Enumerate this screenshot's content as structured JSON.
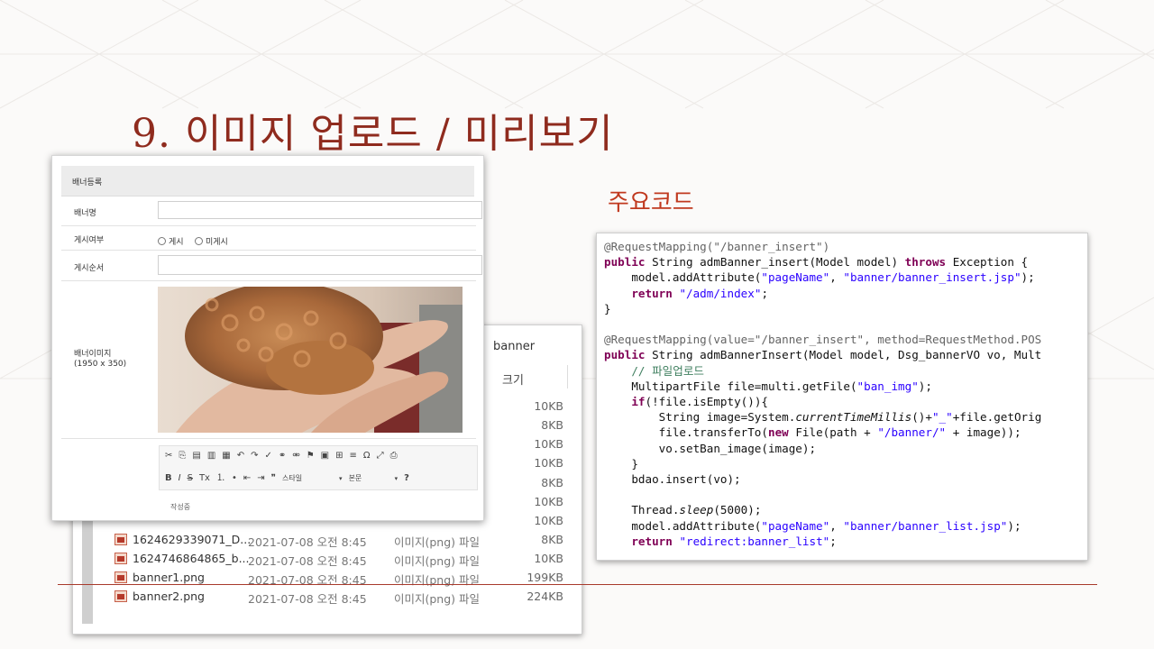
{
  "slide": {
    "title": "9. 이미지 업로드 / 미리보기",
    "code_heading": "주요코드"
  },
  "explorer": {
    "crumb": "banner",
    "col_size": "크기",
    "sizes_top": [
      "10KB",
      "8KB",
      "10KB",
      "10KB",
      "8KB",
      "10KB",
      "10KB"
    ],
    "rows": [
      {
        "name": "1624629339071_D...",
        "date": "2021-07-08 오전 8:45",
        "type": "이미지(png) 파일",
        "size": "8KB"
      },
      {
        "name": "1624746864865_b...",
        "date": "2021-07-08 오전 8:45",
        "type": "이미지(png) 파일",
        "size": "10KB"
      },
      {
        "name": "banner1.png",
        "date": "2021-07-08 오전 8:45",
        "type": "이미지(png) 파일",
        "size": "199KB"
      },
      {
        "name": "banner2.png",
        "date": "2021-07-08 오전 8:45",
        "type": "이미지(png) 파일",
        "size": "224KB"
      }
    ]
  },
  "form": {
    "header": "배너등록",
    "name_label": "배너명",
    "post_label": "게시여부",
    "post_option_yes": "게시",
    "post_option_no": "미게시",
    "order_label": "게시순서",
    "image_label": "배너이미지",
    "image_size": "(1950 x 350)",
    "toolbar_style": "스타일",
    "toolbar_format": "본문",
    "drafts": "작성중"
  },
  "code_lines": [
    "@RequestMapping(\"/banner_insert\")",
    "public String admBanner_insert(Model model) throws Exception {",
    "    model.addAttribute(\"pageName\", \"banner/banner_insert.jsp\");",
    "    return \"/adm/index\";",
    "}",
    "",
    "@RequestMapping(value=\"/banner_insert\", method=RequestMethod.POS",
    "public String admBannerInsert(Model model, Dsg_bannerVO vo, Mult",
    "    // 파일업로드",
    "    MultipartFile file=multi.getFile(\"ban_img\");",
    "    if(!file.isEmpty()){",
    "        String image=System.currentTimeMillis()+\"_\"+file.getOrig",
    "        file.transferTo(new File(path + \"/banner/\" + image));",
    "        vo.setBan_image(image);",
    "    }",
    "    bdao.insert(vo);",
    "",
    "    Thread.sleep(5000);",
    "    model.addAttribute(\"pageName\", \"banner/banner_list.jsp\");",
    "    return \"redirect:banner_list\";"
  ]
}
